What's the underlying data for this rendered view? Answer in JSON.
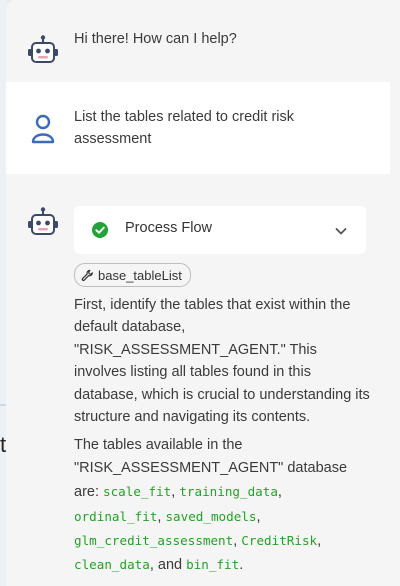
{
  "messages": [
    {
      "role": "assistant",
      "avatar_icon": "robot-icon",
      "text": "Hi there! How can I help?"
    },
    {
      "role": "user",
      "avatar_icon": "user-icon",
      "text": "List the tables related to credit risk assessment"
    }
  ],
  "response": {
    "avatar_icon": "robot-icon",
    "process_flow": {
      "label": "Process Flow",
      "status_icon": "check-circle-icon",
      "status_color": "#22a33a",
      "expand_icon": "chevron-down-icon"
    },
    "tool_badge": {
      "icon": "wrench-icon",
      "label": "base_tableList"
    },
    "paragraph1": "First, identify the tables that exist within the default database, \"RISK_ASSESSMENT_AGENT.\" This involves listing all tables found in this database, which is crucial to understanding its structure and navigating its contents.",
    "paragraph2": {
      "intro": "The tables available in the \"RISK_ASSESSMENT_AGENT\" database are: ",
      "tables": [
        "scale_fit",
        "training_data",
        "ordinal_fit",
        "saved_models",
        "glm_credit_assessment",
        "CreditRisk",
        "clean_data",
        "bin_fit"
      ],
      "sep": ", ",
      "last_sep": ", and ",
      "end": "."
    }
  },
  "background": {
    "stub_char": "t"
  },
  "colors": {
    "code": "#22a325",
    "text": "#3a3a3a",
    "robot_stroke": "#3b4a6b",
    "robot_accent": "#e9a3b3"
  }
}
